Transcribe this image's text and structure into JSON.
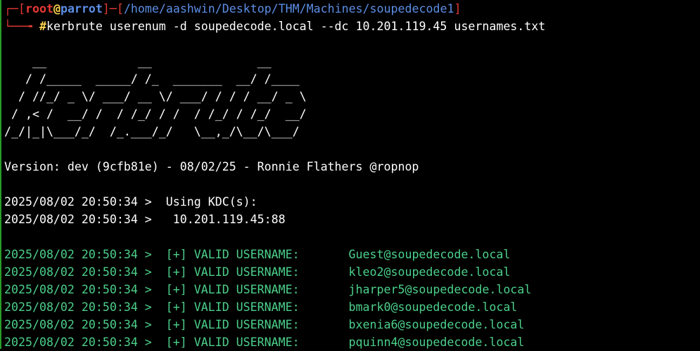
{
  "prompt": {
    "open_bracket": "┌─[",
    "user": "root",
    "at": "@",
    "host": "parrot",
    "sep": "]─[",
    "path": "/home/aashwin/Desktop/THM/Machines/soupedecode1",
    "close_bracket": "]",
    "line2_prefix": "└──╼ ",
    "hash": "#",
    "command": "kerbrute userenum -d soupedecode.local --dc 10.201.119.45 usernames.txt"
  },
  "banner": [
    "",
    "    __             __               __     ",
    "   / /_____  _____/ /_  _______  __/ /____ ",
    "  / //_/ _ \\/ ___/ __ \\/ ___/ / / / __/ _ \\",
    " / ,< /  __/ /  / /_/ / /  / /_/ / /_/  __/",
    "/_/|_|\\___/_/  /_.___/_/   \\__,_/\\__/\\___/ ",
    ""
  ],
  "version_line": "Version: dev (9cfb81e) - 08/02/25 - Ronnie Flathers @ropnop",
  "info_lines": [
    "2025/08/02 20:50:34 >  Using KDC(s):",
    "2025/08/02 20:50:34 >   10.201.119.45:88"
  ],
  "valid_users": [
    {
      "prefix": "2025/08/02 20:50:34 >  [+] VALID USERNAME:",
      "user": "Guest@soupedecode.local"
    },
    {
      "prefix": "2025/08/02 20:50:34 >  [+] VALID USERNAME:",
      "user": "kleo2@soupedecode.local"
    },
    {
      "prefix": "2025/08/02 20:50:34 >  [+] VALID USERNAME:",
      "user": "jharper5@soupedecode.local"
    },
    {
      "prefix": "2025/08/02 20:50:34 >  [+] VALID USERNAME:",
      "user": "bmark0@soupedecode.local"
    },
    {
      "prefix": "2025/08/02 20:50:34 >  [+] VALID USERNAME:",
      "user": "bxenia6@soupedecode.local"
    },
    {
      "prefix": "2025/08/02 20:50:34 >  [+] VALID USERNAME:",
      "user": "pquinn4@soupedecode.local"
    }
  ],
  "colors": {
    "prompt_red": "#e53935",
    "host_blue": "#5c8ee6",
    "valid_green": "#4cd08a",
    "hash_yellow": "#ffd54f"
  }
}
